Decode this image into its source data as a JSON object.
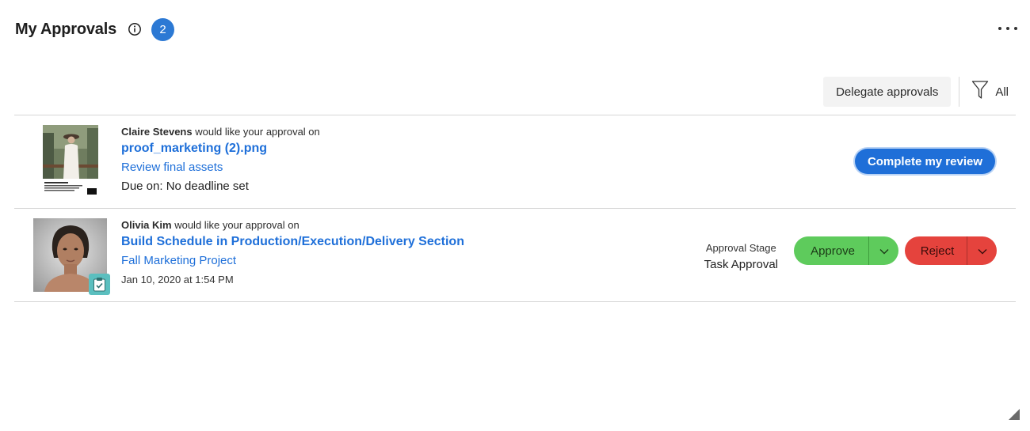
{
  "header": {
    "title": "My Approvals",
    "count": "2",
    "info_icon": "info-circle-icon",
    "more_icon": "more-horizontal-icon"
  },
  "toolbar": {
    "delegate_label": "Delegate approvals",
    "filter_icon": "funnel-icon",
    "filter_label": "All"
  },
  "approvals": [
    {
      "requester": "Claire Stevens",
      "request_text": "would like your approval on",
      "item_title": "proof_marketing (2).png",
      "project": "Review final assets",
      "due": "Due on: No deadline set",
      "action_label": "Complete my review"
    },
    {
      "requester": "Olivia Kim",
      "request_text": "would like your approval on",
      "item_title": "Build Schedule in Production/Execution/Delivery Section",
      "project": "Fall Marketing Project",
      "date": "Jan 10, 2020 at 1:54 PM",
      "stage_label": "Approval Stage",
      "stage_value": "Task Approval",
      "approve_label": "Approve",
      "reject_label": "Reject",
      "task_icon": "clipboard-check-icon"
    }
  ],
  "colors": {
    "accent": "#1e6fd9",
    "badge": "#2c79d4",
    "approve": "#5ecb5c",
    "reject": "#e5433d"
  }
}
